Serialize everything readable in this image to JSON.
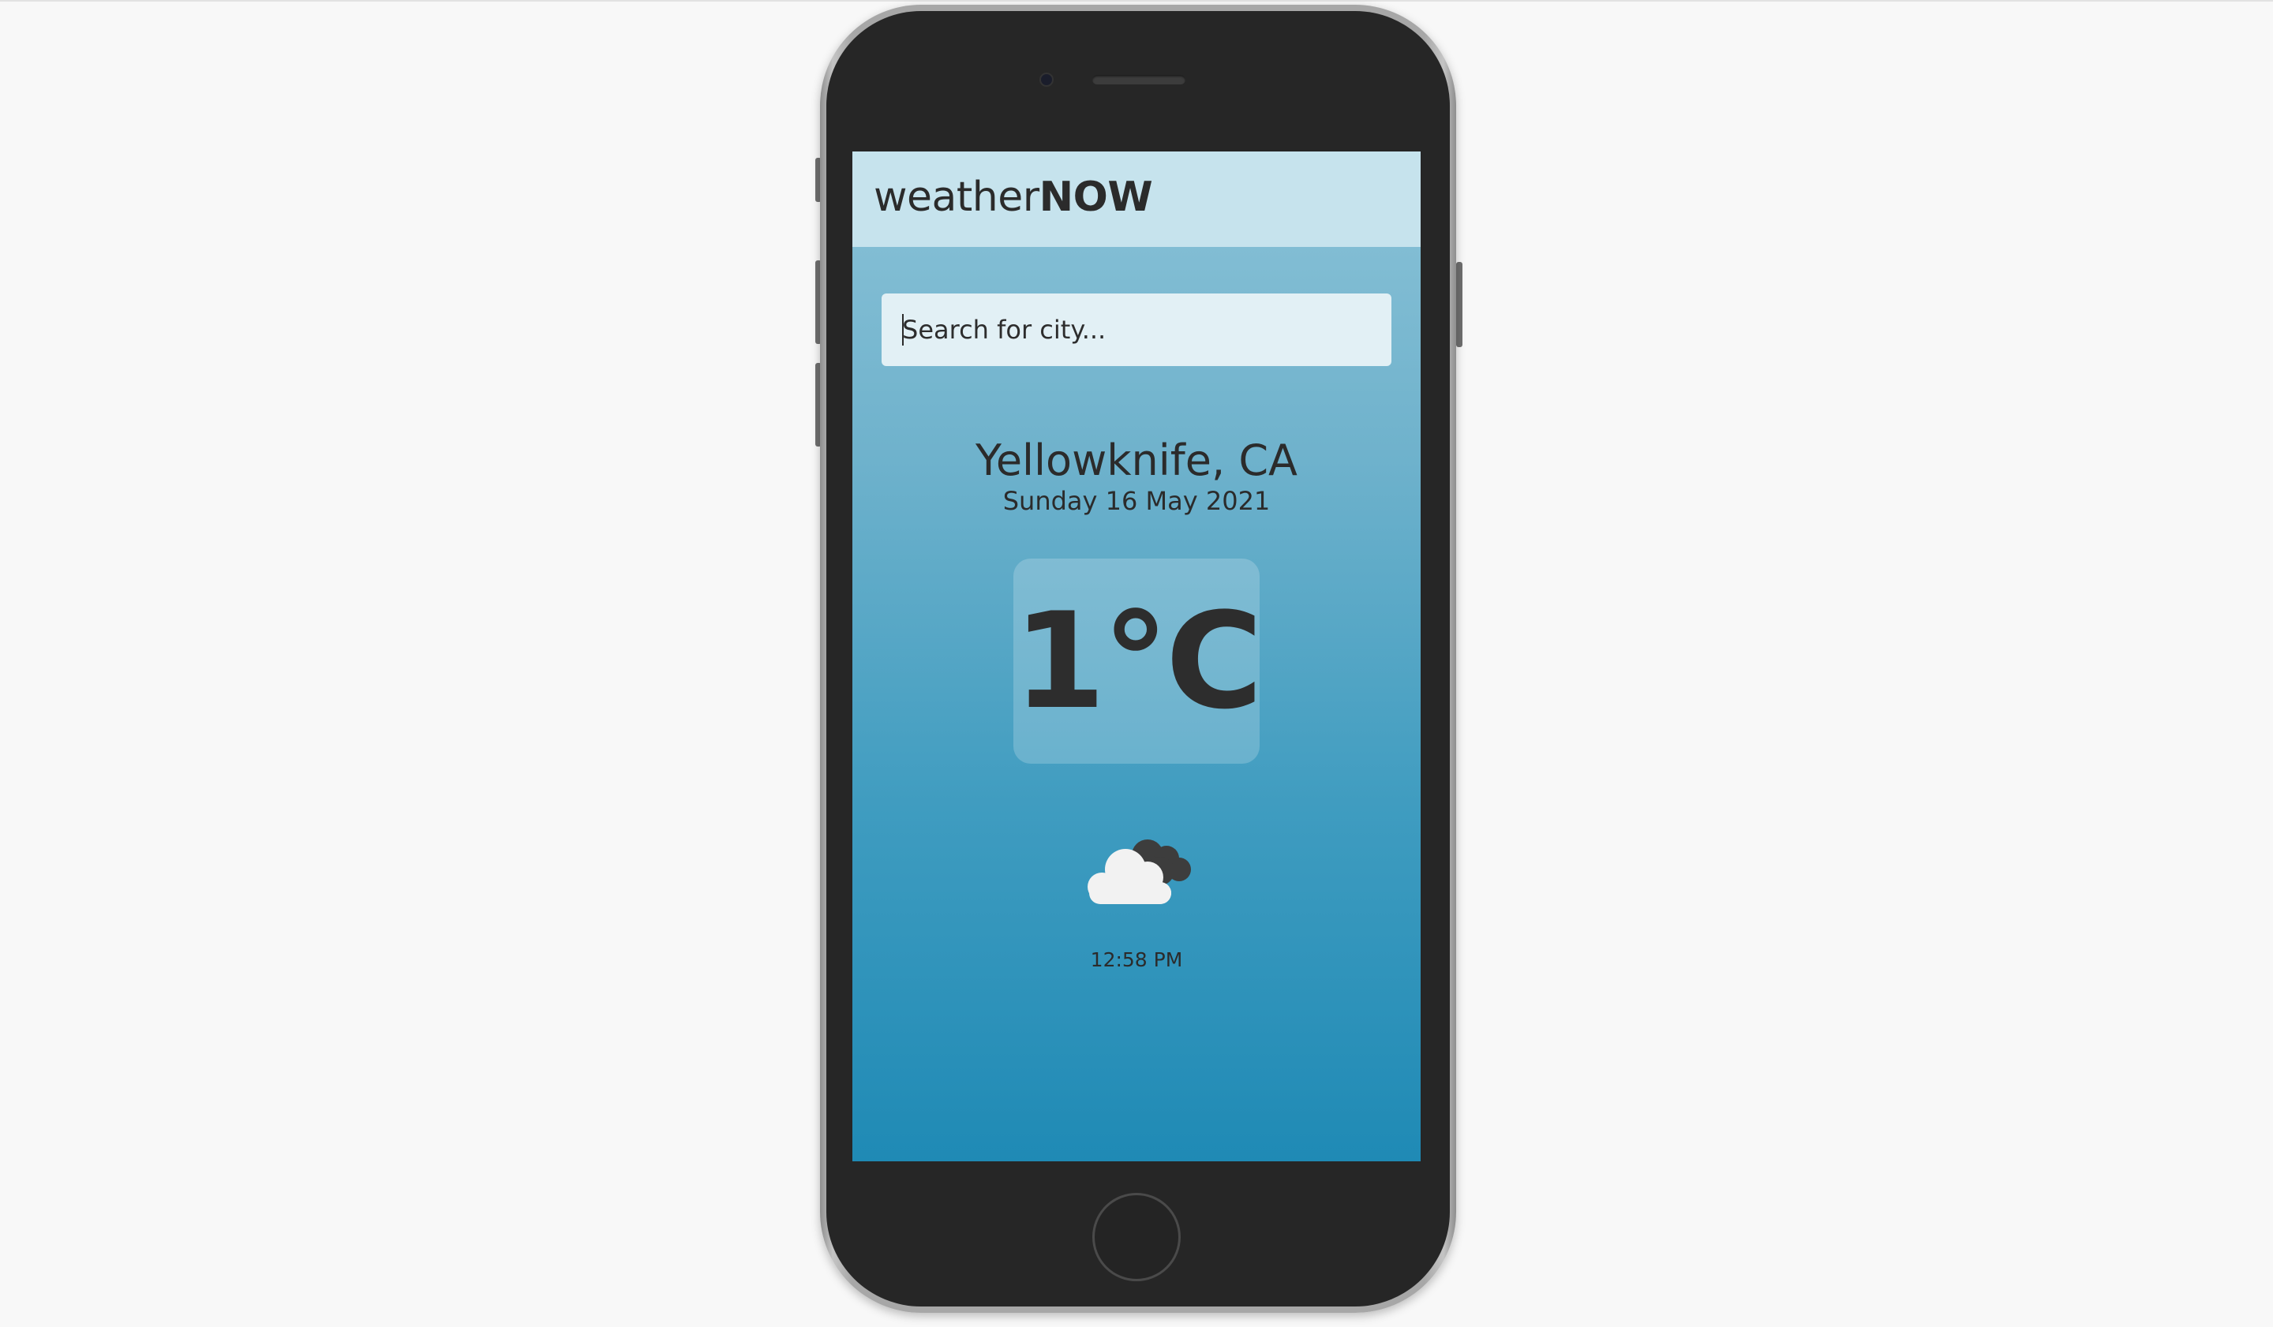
{
  "app": {
    "brand_light": "weather",
    "brand_bold": "NOW"
  },
  "search": {
    "placeholder": "Search for city...",
    "value": ""
  },
  "weather": {
    "location": "Yellowknife, CA",
    "date": "Sunday 16 May 2021",
    "temperature": "1°C",
    "condition_icon": "cloud-icon",
    "time": "12:58 PM"
  },
  "colors": {
    "header_bg": "#c6e3ed",
    "screen_top": "#8ac2d7",
    "screen_bottom": "#1f8ab5",
    "text": "#2b2b2b",
    "phone_body": "#262626"
  }
}
